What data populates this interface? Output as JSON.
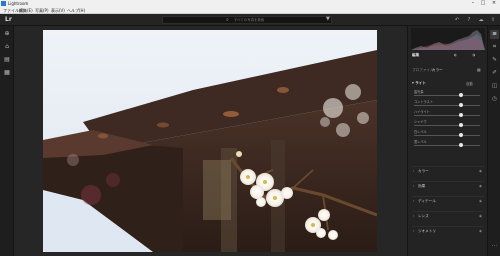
{
  "app": {
    "title": "Lightroom"
  },
  "menu": [
    "ファイル(F)",
    "編集(E)",
    "写真(P)",
    "表示(V)",
    "ヘルプ(H)"
  ],
  "toolbar": {
    "logo": "Lr",
    "search_placeholder": "すべての写真を検索"
  },
  "panel": {
    "edit_title": "編集",
    "profile_label": "プロファイル",
    "profile_value": "カラー",
    "light_label": "ライト",
    "light_auto": "自動",
    "sliders": [
      {
        "label": "露光量",
        "value": 0.5
      },
      {
        "label": "コントラスト",
        "value": 0.5
      },
      {
        "label": "ハイライト",
        "value": 0.5
      },
      {
        "label": "シャドウ",
        "value": 0.5
      },
      {
        "label": "白レベル",
        "value": 0.5
      },
      {
        "label": "黒レベル",
        "value": 0.5
      }
    ],
    "sections": [
      "カラー",
      "効果",
      "ディテール",
      "レンズ",
      "ジオメトリ"
    ]
  },
  "colors": {
    "accent": "#2b79c8",
    "panel_bg": "#232323",
    "canvas_bg": "#262626"
  },
  "icons": {
    "left_rail": [
      "add-photo-icon",
      "home-icon",
      "library-icon",
      "grid-icon"
    ],
    "right_rail": [
      "edit-sliders-icon",
      "crop-icon",
      "healing-icon",
      "brush-icon",
      "presets-icon",
      "versions-icon",
      "more-icon"
    ],
    "toolbar": [
      "undo-icon",
      "help-icon",
      "cloud-sync-icon",
      "share-icon",
      "search-icon",
      "filter-icon"
    ]
  }
}
